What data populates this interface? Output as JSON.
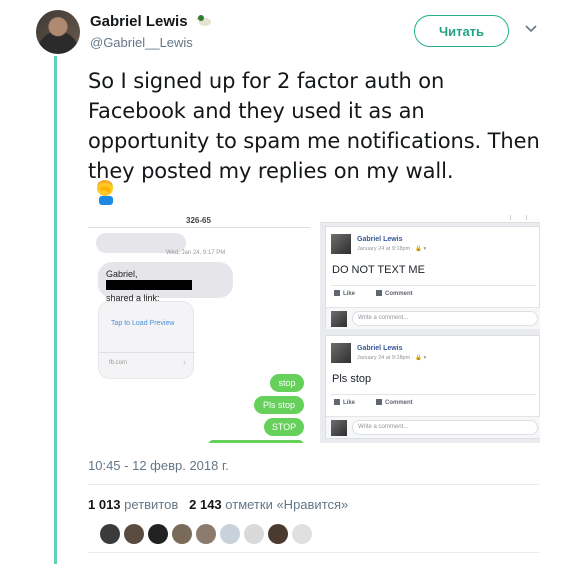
{
  "author": {
    "name": "Gabriel Lewis",
    "handle": "@Gabriel__Lewis",
    "name_emoji": "duck-emoji"
  },
  "follow_label": "Читать",
  "tweet_text": "So I signed up for 2 factor auth on Facebook and they used it as an opportunity to spam me notifications. Then they posted my replies on my wall.",
  "tweet_emoji": "facepalm-emoji",
  "phone": {
    "number": "326-65",
    "date": "Wed, Jan 24, 9:17 PM",
    "grey_message_line1": "Gabriel,",
    "grey_message_line2": "shared a link:",
    "preview_link": "Tap to Load Preview",
    "preview_domain": "fb.com",
    "replies": [
      "stop",
      "Pls stop",
      "STOP"
    ]
  },
  "facebook": {
    "posts": [
      {
        "name": "Gabriel Lewis",
        "time": "January 24 at 9:18pm · 🔒 ▾",
        "body": "DO NOT TEXT ME",
        "like": "Like",
        "comment": "Comment",
        "write": "Write a comment..."
      },
      {
        "name": "Gabriel Lewis",
        "time": "January 24 at 9:18pm · 🔒 ▾",
        "body": "Pls stop",
        "like": "Like",
        "comment": "Comment",
        "write": "Write a comment..."
      }
    ]
  },
  "timestamp": "10:45 - 12 февр. 2018 г.",
  "stats": {
    "retweets_count": "1 013",
    "retweets_label": "ретвитов",
    "likes_count": "2 143",
    "likes_label": "отметки «Нравится»"
  },
  "liker_colors": [
    "#3b3b3b",
    "#5a4b40",
    "#222222",
    "#7a6a5a",
    "#8c7a6c",
    "#c9d2da",
    "#d9d9d9",
    "#4a3a30",
    "#e0e0e0"
  ]
}
